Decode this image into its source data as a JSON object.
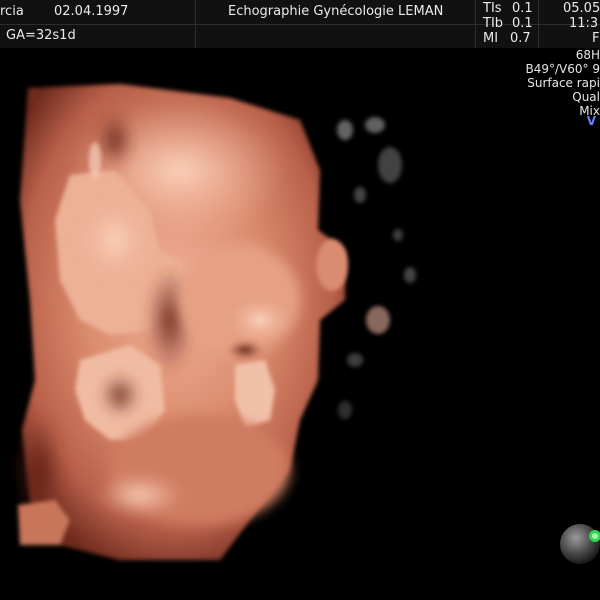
{
  "header": {
    "patient_name": "rcia",
    "exam_date": "02.04.1997",
    "clinic": "Echographie Gynécologie LEMAN",
    "gestational_age": "GA=32s1d",
    "date": "05.05.",
    "time": "11:3",
    "right_col_letter": "F"
  },
  "indices": [
    {
      "label": "TIs",
      "value": "0.1"
    },
    {
      "label": "TIb",
      "value": "0.1"
    },
    {
      "label": "MI",
      "value": "0.7"
    }
  ],
  "side_info": {
    "frequency": "68H",
    "angles": "B49°/V60° 9",
    "mode": "Surface rapi",
    "quality": "Qual",
    "mix": "Mix",
    "v_marker": "V"
  },
  "colors": {
    "background": "#000000",
    "header_bg": "#111111",
    "skin_tone": "#d8876b",
    "accent_blue": "#6f7cff",
    "orient_green": "#2fd84a"
  }
}
